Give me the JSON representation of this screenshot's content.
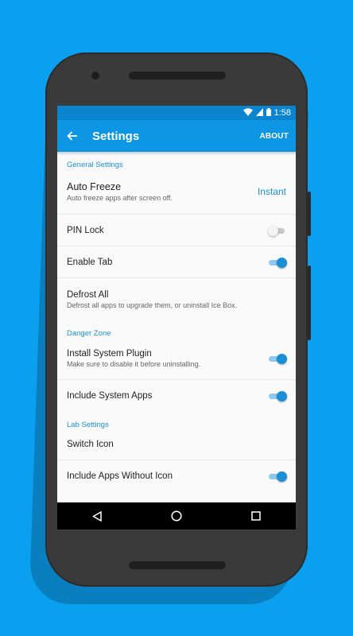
{
  "status": {
    "time": "1:58"
  },
  "appbar": {
    "title": "Settings",
    "about": "ABOUT"
  },
  "sections": {
    "general": "General Settings",
    "danger": "Danger Zone",
    "lab": "Lab Settings"
  },
  "settings": {
    "auto_freeze": {
      "label": "Auto Freeze",
      "sub": "Auto freeze apps after screen off.",
      "value": "Instant"
    },
    "pin_lock": {
      "label": "PIN Lock",
      "enabled": false
    },
    "enable_tab": {
      "label": "Enable Tab",
      "enabled": true
    },
    "defrost_all": {
      "label": "Defrost All",
      "sub": "Defrost all apps to upgrade them, or uninstall Ice Box."
    },
    "install_plugin": {
      "label": "Install System Plugin",
      "sub": "Make sure to disable it before uninstalling.",
      "enabled": true
    },
    "include_system": {
      "label": "Include System Apps",
      "enabled": true
    },
    "switch_icon": {
      "label": "Switch Icon"
    },
    "include_no_icon": {
      "label": "Include Apps Without Icon",
      "enabled": true
    }
  },
  "colors": {
    "background": "#0aa0ef",
    "appbar": "#0d96e4",
    "statusbar": "#0a84cf",
    "accent": "#1a8fd8"
  },
  "icons": {
    "wifi": "wifi-icon",
    "signal": "signal-icon",
    "battery": "battery-icon",
    "back": "arrow-left-icon",
    "nav_back": "triangle-back-icon",
    "nav_home": "circle-home-icon",
    "nav_recents": "square-recents-icon"
  }
}
